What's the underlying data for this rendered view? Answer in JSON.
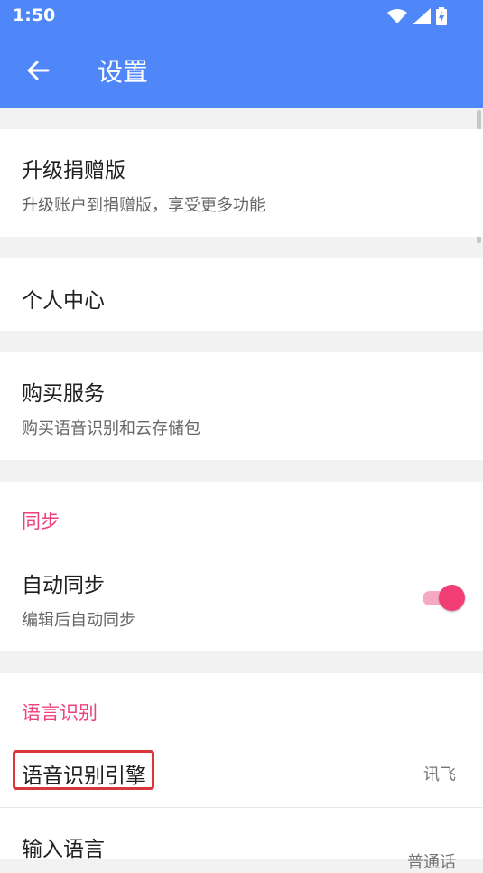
{
  "status": {
    "time": "1:50"
  },
  "header": {
    "title": "设置"
  },
  "items": {
    "upgrade": {
      "title": "升级捐赠版",
      "subtitle": "升级账户到捐赠版，享受更多功能"
    },
    "personal": {
      "title": "个人中心"
    },
    "purchase": {
      "title": "购买服务",
      "subtitle": "购买语音识别和云存储包"
    }
  },
  "sync": {
    "section": "同步",
    "auto": {
      "title": "自动同步",
      "subtitle": "编辑后自动同步",
      "enabled": true
    }
  },
  "speech": {
    "section": "语言识别",
    "engine": {
      "title": "语音识别引擎",
      "value": "讯飞"
    },
    "language": {
      "title": "输入语言",
      "value": "普通话"
    }
  },
  "colors": {
    "appbar": "#5087f8",
    "accent": "#ef3f7c",
    "highlight": "#d7373a"
  }
}
